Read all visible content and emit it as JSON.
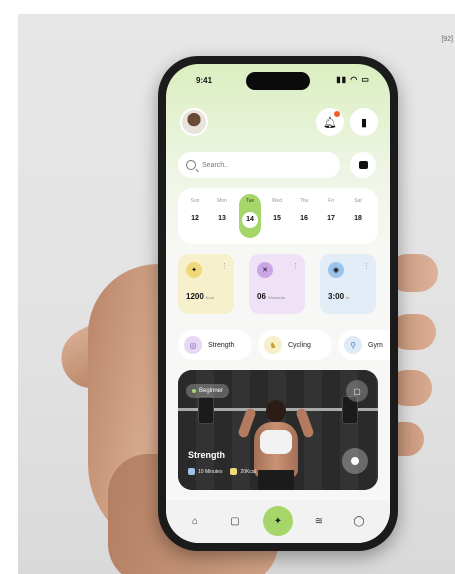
{
  "corner_label": "[92]",
  "status_bar": {
    "time": "9:41",
    "icons": "▮▮ ◠ ▭"
  },
  "header": {
    "avatar": "user-avatar",
    "bell_icon": "bell-icon",
    "bookmark_icon": "bookmark-icon"
  },
  "search": {
    "placeholder": "Search.."
  },
  "week": {
    "days": [
      {
        "name": "Sun",
        "date": "12",
        "active": false
      },
      {
        "name": "Mon",
        "date": "13",
        "active": false
      },
      {
        "name": "Tue",
        "date": "14",
        "active": true
      },
      {
        "name": "Wed",
        "date": "15",
        "active": false
      },
      {
        "name": "Thu",
        "date": "16",
        "active": false
      },
      {
        "name": "Fri",
        "date": "17",
        "active": false
      },
      {
        "name": "Sat",
        "date": "18",
        "active": false
      }
    ]
  },
  "stats": [
    {
      "value": "1200",
      "unit": "Kcal",
      "icon": "flame-icon",
      "icon_glyph": "✦"
    },
    {
      "value": "06",
      "unit": "Workouts",
      "icon": "dumbbell-icon",
      "icon_glyph": "✕"
    },
    {
      "value": "3:00",
      "unit": "hr",
      "icon": "clock-icon",
      "icon_glyph": "◉"
    }
  ],
  "stat_more": "⋮",
  "categories": [
    {
      "label": "Strength",
      "icon": "strength-icon",
      "glyph": "◎"
    },
    {
      "label": "Cycling",
      "icon": "cycling-icon",
      "glyph": "♞"
    },
    {
      "label": "Gym",
      "icon": "gym-icon",
      "glyph": "⚲"
    }
  ],
  "workout_card": {
    "level": "Beginner",
    "title": "Strength",
    "duration": "10 Minutes",
    "calories": "20Kcal",
    "play_icon": "play-icon"
  },
  "tabbar": {
    "tabs": [
      {
        "icon": "home-icon",
        "glyph": "⌂",
        "active": false
      },
      {
        "icon": "calendar-icon",
        "glyph": "▢",
        "active": false
      },
      {
        "icon": "run-icon",
        "glyph": "✦",
        "active": true
      },
      {
        "icon": "stats-icon",
        "glyph": "≋",
        "active": false
      },
      {
        "icon": "profile-icon",
        "glyph": "◯",
        "active": false
      }
    ]
  },
  "colors": {
    "accent": "#a6d56a",
    "notification": "#f0602a"
  }
}
